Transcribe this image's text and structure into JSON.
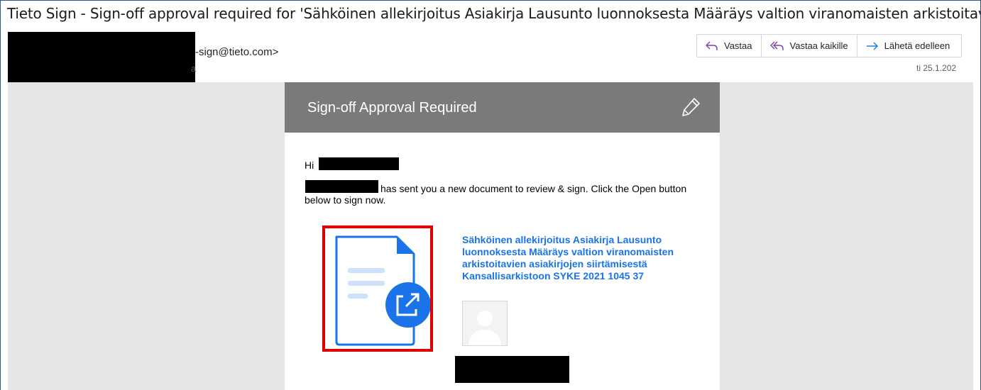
{
  "email": {
    "subject": "Tieto Sign - Sign-off approval required for 'Sähköinen allekirjoitus   Asiakirja  Lausunto luonnoksesta Määräys valtion viranomaisten arkistoitavien",
    "sender_email": "-sign@tieto.com>",
    "sender_sub": "a",
    "date": "ti 25.1.202"
  },
  "actions": {
    "reply": "Vastaa",
    "reply_all": "Vastaa kaikille",
    "forward": "Lähetä edelleen"
  },
  "card": {
    "title": "Sign-off Approval Required",
    "greeting": "Hi",
    "message": "has sent you a new document to review & sign. Click the Open button below to sign now.",
    "document_title": "Sähköinen allekirjoitus Asiakirja Lausunto luonnoksesta Määräys valtion viranomaisten arkistoitavien asiakirjojen siirtämisestä Kansallisarkistoon SYKE 2021 1045 37"
  },
  "colors": {
    "accent_purple": "#7b3fb5",
    "accent_blue": "#1a73e8",
    "header_gray": "#7a7a7a",
    "highlight_red": "#e00000"
  },
  "icons": {
    "reply": "reply-icon",
    "reply_all": "reply-all-icon",
    "forward": "forward-icon",
    "pen": "pen-icon",
    "document": "document-open-icon",
    "avatar": "user-avatar-icon"
  }
}
